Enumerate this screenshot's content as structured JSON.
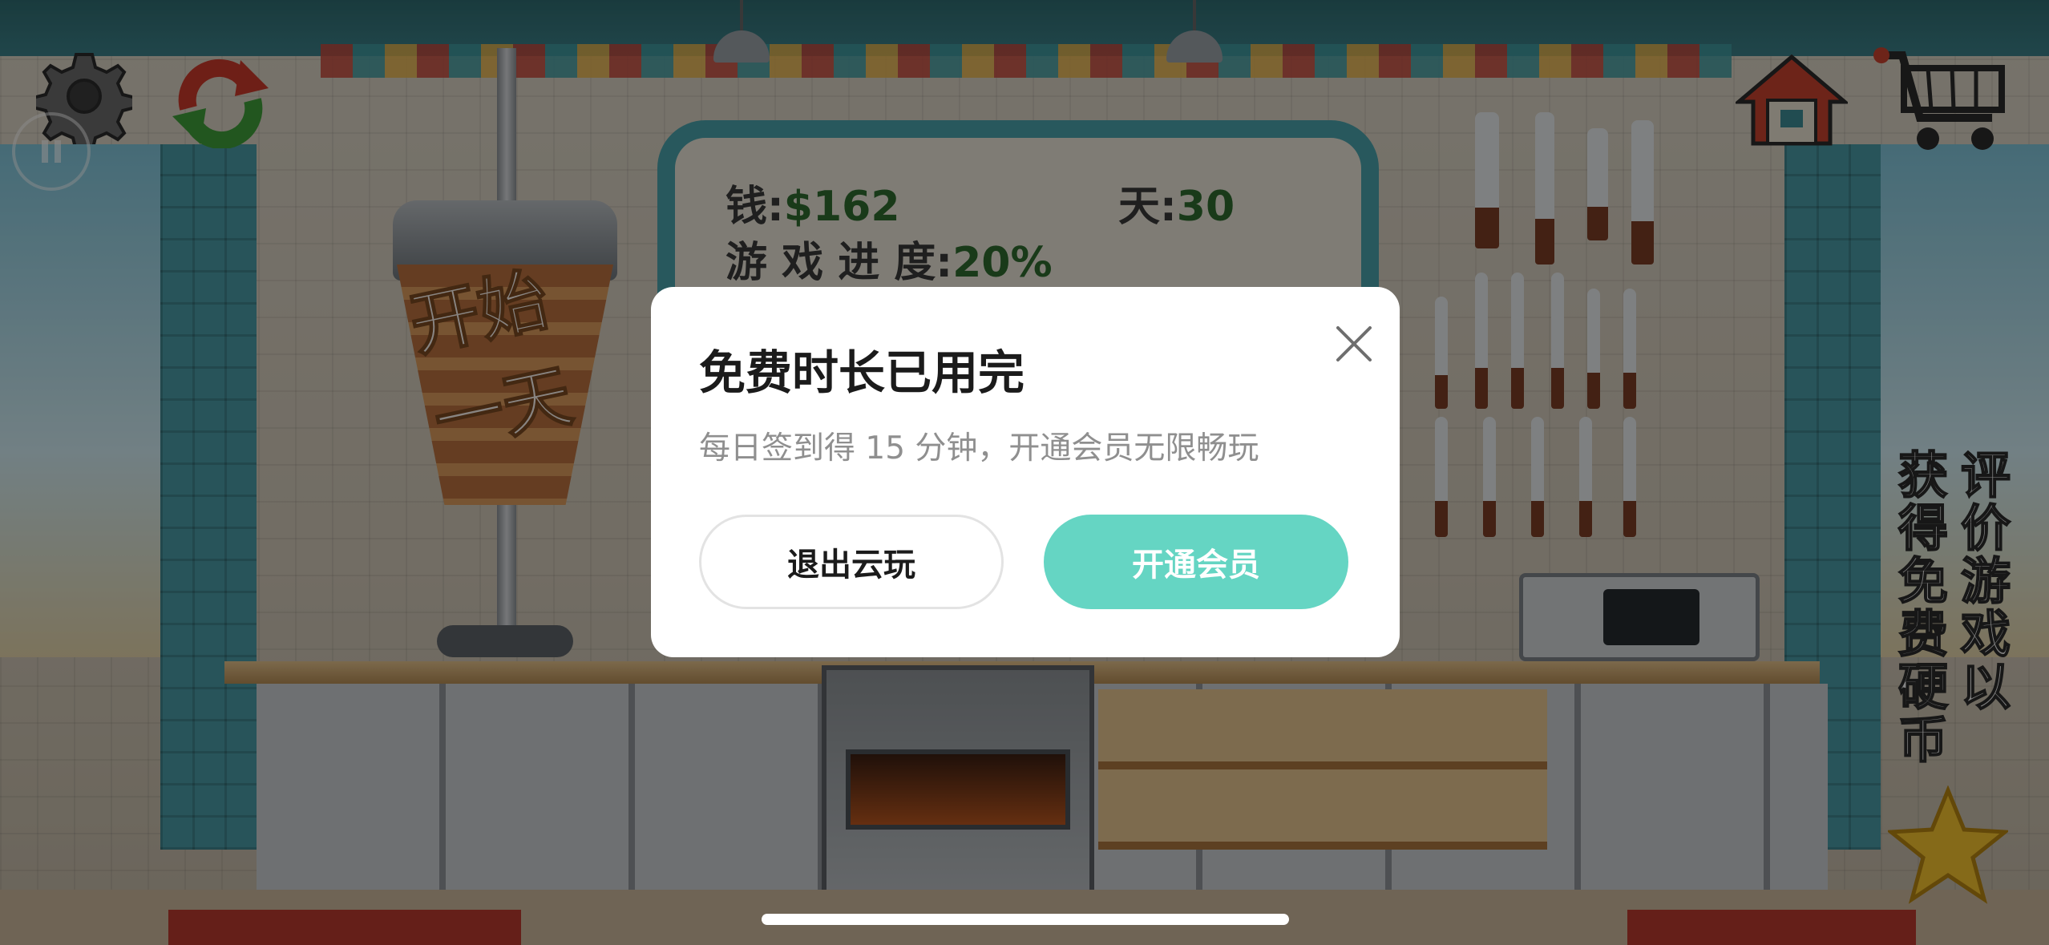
{
  "scene": {
    "board": {
      "money_label": "钱:",
      "money_value": "$162",
      "day_label": "天:",
      "day_value": "30",
      "progress_label": "游 戏 进 度:",
      "progress_value": "20%"
    },
    "kebab_text_line1": "开始",
    "kebab_text_line2": "一天",
    "side_promo_line1": "评价游戏以",
    "side_promo_line2": "获得免费硬币"
  },
  "hud": {
    "icons": [
      "gear-icon",
      "refresh-icon",
      "pause-icon",
      "home-icon",
      "cart-icon",
      "star-icon"
    ]
  },
  "dialog": {
    "title": "免费时长已用完",
    "subtitle": "每日签到得 15 分钟，开通会员无限畅玩",
    "exit_label": "退出云玩",
    "vip_label": "开通会员",
    "accent": "#65d5c3"
  }
}
